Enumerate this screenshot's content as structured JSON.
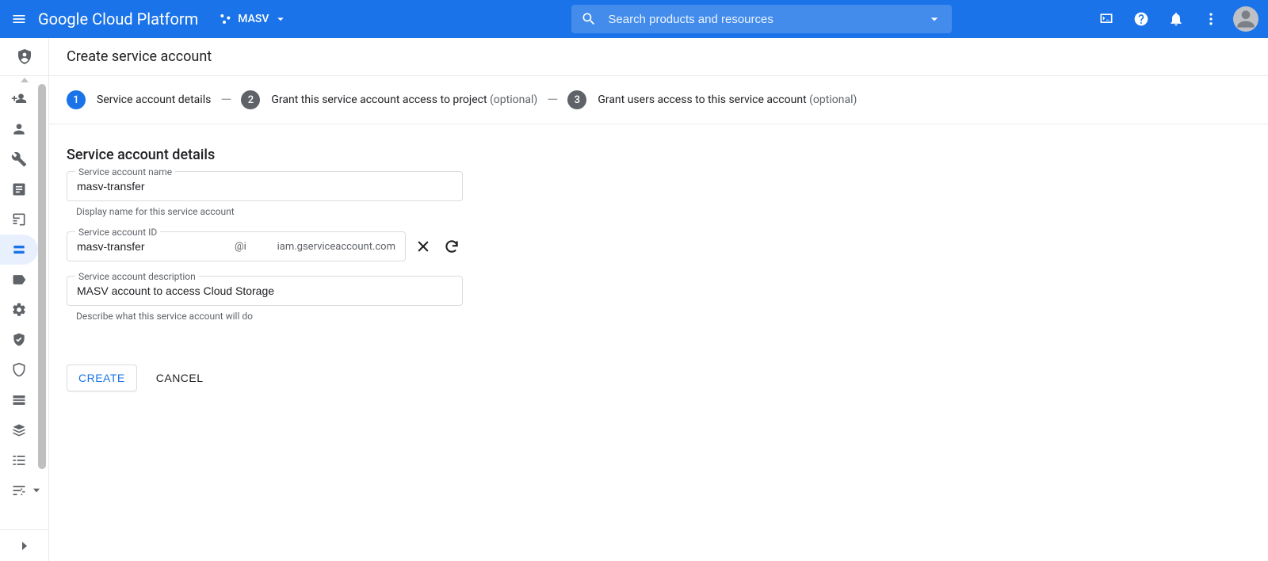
{
  "header": {
    "brand": "Google Cloud Platform",
    "project_name": "MASV",
    "search_placeholder": "Search products and resources"
  },
  "page": {
    "title": "Create service account"
  },
  "stepper": {
    "steps": [
      {
        "num": "1",
        "label": "Service account details"
      },
      {
        "num": "2",
        "label": "Grant this service account access to project",
        "optional": "(optional)"
      },
      {
        "num": "3",
        "label": "Grant users access to this service account",
        "optional": "(optional)"
      }
    ]
  },
  "form": {
    "heading": "Service account details",
    "name_label": "Service account name",
    "name_value": "masv-transfer",
    "name_hint": "Display name for this service account",
    "id_label": "Service account ID",
    "id_value": "masv-transfer",
    "id_at": "@i",
    "id_domain": "iam.gserviceaccount.com",
    "desc_label": "Service account description",
    "desc_value": "MASV account to access Cloud Storage",
    "desc_hint": "Describe what this service account will do"
  },
  "buttons": {
    "create": "CREATE",
    "cancel": "CANCEL"
  }
}
